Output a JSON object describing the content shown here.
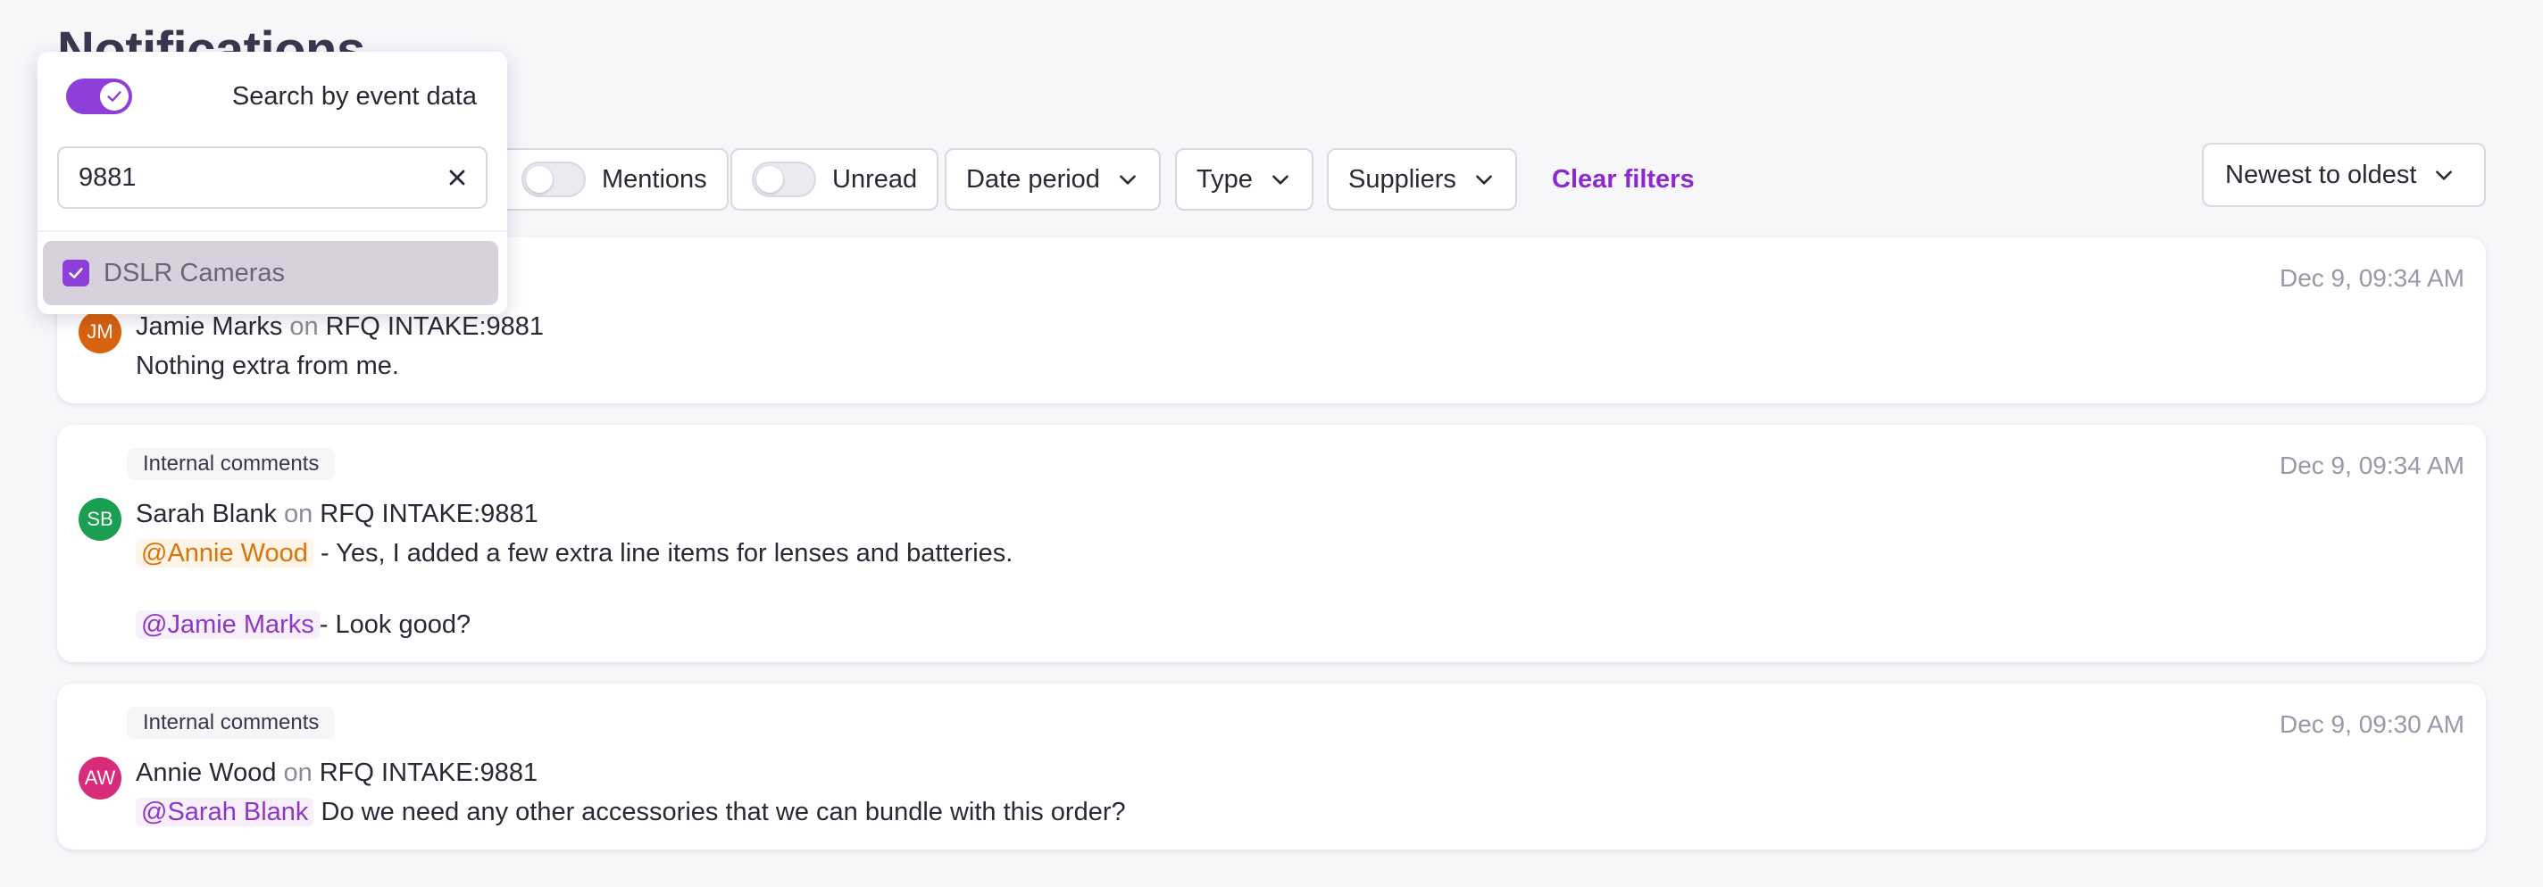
{
  "page": {
    "title": "Notifications"
  },
  "popover": {
    "toggle_label": "Search by event data",
    "search_value": "9881",
    "option_label": "DSLR Cameras"
  },
  "filters": {
    "mentions_label": "Mentions",
    "unread_label": "Unread",
    "date_period_label": "Date period",
    "type_label": "Type",
    "suppliers_label": "Suppliers",
    "clear_label": "Clear filters",
    "sort_label": "Newest to oldest"
  },
  "notifications": [
    {
      "time": "Dec 9, 09:34 AM",
      "author": "Jamie Marks",
      "initials": "JM",
      "avatar_color": "#d9620f",
      "connector": "on",
      "target": "RFQ INTAKE:9881",
      "message": "Nothing extra from me."
    },
    {
      "tag": "Internal comments",
      "time": "Dec 9, 09:34 AM",
      "author": "Sarah Blank",
      "initials": "SB",
      "avatar_color": "#1a9e52",
      "connector": "on",
      "target": "RFQ INTAKE:9881",
      "line1_mention": "@Annie Wood",
      "line1_text": "- Yes, I added a few extra line items for lenses and batteries.",
      "line2_mention": "@Jamie Marks",
      "line2_text": "- Look good?"
    },
    {
      "tag": "Internal comments",
      "time": "Dec 9, 09:30 AM",
      "author": "Annie Wood",
      "initials": "AW",
      "avatar_color": "#d82b7a",
      "connector": "on",
      "target": "RFQ INTAKE:9881",
      "line1_mention": "@Sarah Blank",
      "line1_text": "Do we need any other accessories that we can bundle with this order?"
    }
  ],
  "colors": {
    "accent": "#8e3fd9",
    "link": "#8a2ad0",
    "mention_orange": "#d9740b",
    "mention_purple": "#9036c7"
  }
}
